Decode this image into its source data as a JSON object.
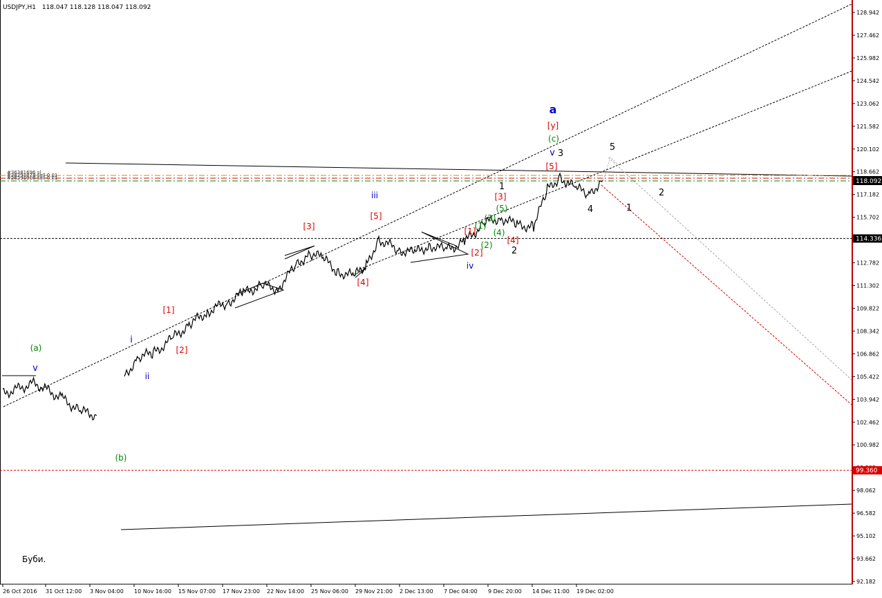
{
  "header": {
    "symbol_timeframe": "USDJPY,H1",
    "ohlc": "118.047 118.128 118.047 118.092"
  },
  "footer_note": "Буби.",
  "price_axis": {
    "min": 92.182,
    "max": 129.422,
    "ticks": [
      "128.942",
      "127.462",
      "125.982",
      "124.542",
      "123.062",
      "121.582",
      "120.102",
      "118.662",
      "117.182",
      "115.702",
      "114.222",
      "112.782",
      "111.302",
      "109.822",
      "108.342",
      "106.862",
      "105.422",
      "103.942",
      "102.462",
      "100.982",
      "99.502",
      "98.062",
      "96.582",
      "95.102",
      "93.662",
      "92.182"
    ],
    "current_price": "118.092",
    "level_label": "114.336",
    "red_level_label": "99.360"
  },
  "time_axis": {
    "labels": [
      "26 Oct 2016",
      "31 Oct 12:00",
      "3 Nov 04:00",
      "10 Nov 16:00",
      "15 Nov 07:00",
      "17 Nov 23:00",
      "22 Nov 14:00",
      "25 Nov 06:00",
      "29 Nov 21:00",
      "2 Dec 13:00",
      "7 Dec 04:00",
      "9 Dec 20:00",
      "14 Dec 11:00",
      "19 Dec 02:00"
    ]
  },
  "order_labels": [
    "#36381696 sl",
    "#28291878 sell 0.01",
    "#28291908 sell 0.01"
  ],
  "colors": {
    "bg": "#ffffff",
    "axis_line": "#c00000",
    "price": "#000000",
    "wave_blue": "#0000cc",
    "wave_red": "#dd0000",
    "wave_green": "#008800",
    "wave_black": "#000000",
    "level_green": "#008800",
    "level_red": "#dd0000",
    "level_orange": "#cc8800"
  },
  "chart_data": {
    "type": "line",
    "price_series": [
      [
        "26 Oct 2016",
        104.3
      ],
      [
        "31 Oct",
        105.0
      ],
      [
        "1 Nov",
        104.0
      ],
      [
        "2 Nov",
        103.2
      ],
      [
        "3 Nov",
        102.9
      ],
      [
        "9 Nov",
        105.4
      ],
      [
        "10 Nov",
        106.7
      ],
      [
        "11 Nov",
        106.9
      ],
      [
        "14 Nov",
        107.9
      ],
      [
        "15 Nov",
        108.8
      ],
      [
        "16 Nov",
        109.6
      ],
      [
        "17 Nov",
        110.2
      ],
      [
        "18 Nov",
        110.8
      ],
      [
        "21 Nov",
        111.3
      ],
      [
        "22 Nov",
        111.1
      ],
      [
        "23 Nov",
        112.6
      ],
      [
        "24 Nov",
        113.4
      ],
      [
        "25 Nov",
        113.1
      ],
      [
        "28 Nov",
        112.2
      ],
      [
        "29 Nov",
        111.9
      ],
      [
        "30 Nov",
        112.6
      ],
      [
        "1 Dec",
        114.3
      ],
      [
        "2 Dec",
        113.6
      ],
      [
        "5 Dec",
        113.4
      ],
      [
        "6 Dec",
        113.9
      ],
      [
        "7 Dec",
        113.6
      ],
      [
        "8 Dec",
        114.1
      ],
      [
        "9 Dec",
        115.3
      ],
      [
        "12 Dec",
        115.7
      ],
      [
        "13 Dec",
        115.2
      ],
      [
        "14 Dec",
        115.1
      ],
      [
        "15 Dec",
        117.5
      ],
      [
        "16 Dec",
        118.3
      ],
      [
        "19 Dec",
        117.6
      ],
      [
        "20 Dec",
        117.2
      ],
      [
        "21 Dec",
        118.1
      ]
    ],
    "horizontal_levels": [
      {
        "label": "114.336",
        "value": 114.336,
        "style": "dashed-black"
      },
      {
        "label": "99.360",
        "value": 99.36,
        "style": "dashed-red"
      }
    ],
    "wave_labels": [
      {
        "text": "a",
        "color": "wave_blue",
        "x": "15 Dec",
        "y": 122.2,
        "size": "large"
      },
      {
        "text": "[y]",
        "color": "wave_red",
        "x": "15 Dec",
        "y": 121.3
      },
      {
        "text": "(c)",
        "color": "wave_green",
        "x": "15 Dec",
        "y": 120.5
      },
      {
        "text": "v",
        "color": "wave_blue",
        "x": "15 Dec",
        "y": 119.6
      },
      {
        "text": "3",
        "color": "wave_black",
        "x": "15 Dec",
        "y": 119.6
      },
      {
        "text": "[5]",
        "color": "wave_red",
        "x": "15 Dec",
        "y": 118.8
      },
      {
        "text": "5",
        "color": "wave_black",
        "x": "21 Dec",
        "y": 120.1
      },
      {
        "text": "2",
        "color": "wave_black",
        "x": "22 Dec",
        "y": 117.3
      },
      {
        "text": "1",
        "color": "wave_black",
        "x": "21 Dec",
        "y": 116.4
      },
      {
        "text": "4",
        "color": "wave_black",
        "x": "20 Dec",
        "y": 116.3
      },
      {
        "text": "1",
        "color": "wave_black",
        "x": "12 Dec",
        "y": 117.6
      },
      {
        "text": "[3]",
        "color": "wave_red",
        "x": "12 Dec",
        "y": 117.0
      },
      {
        "text": "(5)",
        "color": "wave_green",
        "x": "12 Dec",
        "y": 116.4
      },
      {
        "text": "(3)",
        "color": "wave_green",
        "x": "9 Dec",
        "y": 115.7
      },
      {
        "text": "(1)",
        "color": "wave_green",
        "x": "9 Dec",
        "y": 115.1
      },
      {
        "text": "[1]",
        "color": "wave_red",
        "x": "8 Dec",
        "y": 114.7
      },
      {
        "text": "(4)",
        "color": "wave_green",
        "x": "12 Dec",
        "y": 114.8
      },
      {
        "text": "[4]",
        "color": "wave_red",
        "x": "12 Dec",
        "y": 114.2
      },
      {
        "text": "(2)",
        "color": "wave_green",
        "x": "9 Dec",
        "y": 113.9
      },
      {
        "text": "[2]",
        "color": "wave_red",
        "x": "8 Dec",
        "y": 113.5
      },
      {
        "text": "2",
        "color": "wave_black",
        "x": "12 Dec",
        "y": 113.6
      },
      {
        "text": "iv",
        "color": "wave_blue",
        "x": "8 Dec",
        "y": 112.8
      },
      {
        "text": "iii",
        "color": "wave_blue",
        "x": "30 Nov",
        "y": 117.4
      },
      {
        "text": "[5]",
        "color": "wave_red",
        "x": "30 Nov",
        "y": 115.8
      },
      {
        "text": "[3]",
        "color": "wave_red",
        "x": "23 Nov",
        "y": 115.0
      },
      {
        "text": "[4]",
        "color": "wave_red",
        "x": "29 Nov",
        "y": 111.6
      },
      {
        "text": "[1]",
        "color": "wave_red",
        "x": "14 Nov",
        "y": 109.6
      },
      {
        "text": "[2]",
        "color": "wave_red",
        "x": "14 Nov",
        "y": 107.0
      },
      {
        "text": "i",
        "color": "wave_blue",
        "x": "10 Nov",
        "y": 108.0
      },
      {
        "text": "ii",
        "color": "wave_blue",
        "x": "10 Nov",
        "y": 106.4
      },
      {
        "text": "v",
        "color": "wave_blue",
        "x": "31 Oct",
        "y": 106.3
      },
      {
        "text": "(a)",
        "color": "wave_green",
        "x": "31 Oct",
        "y": 107.2
      },
      {
        "text": "(b)",
        "color": "wave_green",
        "x": "3 Nov",
        "y": 100.1
      }
    ]
  }
}
